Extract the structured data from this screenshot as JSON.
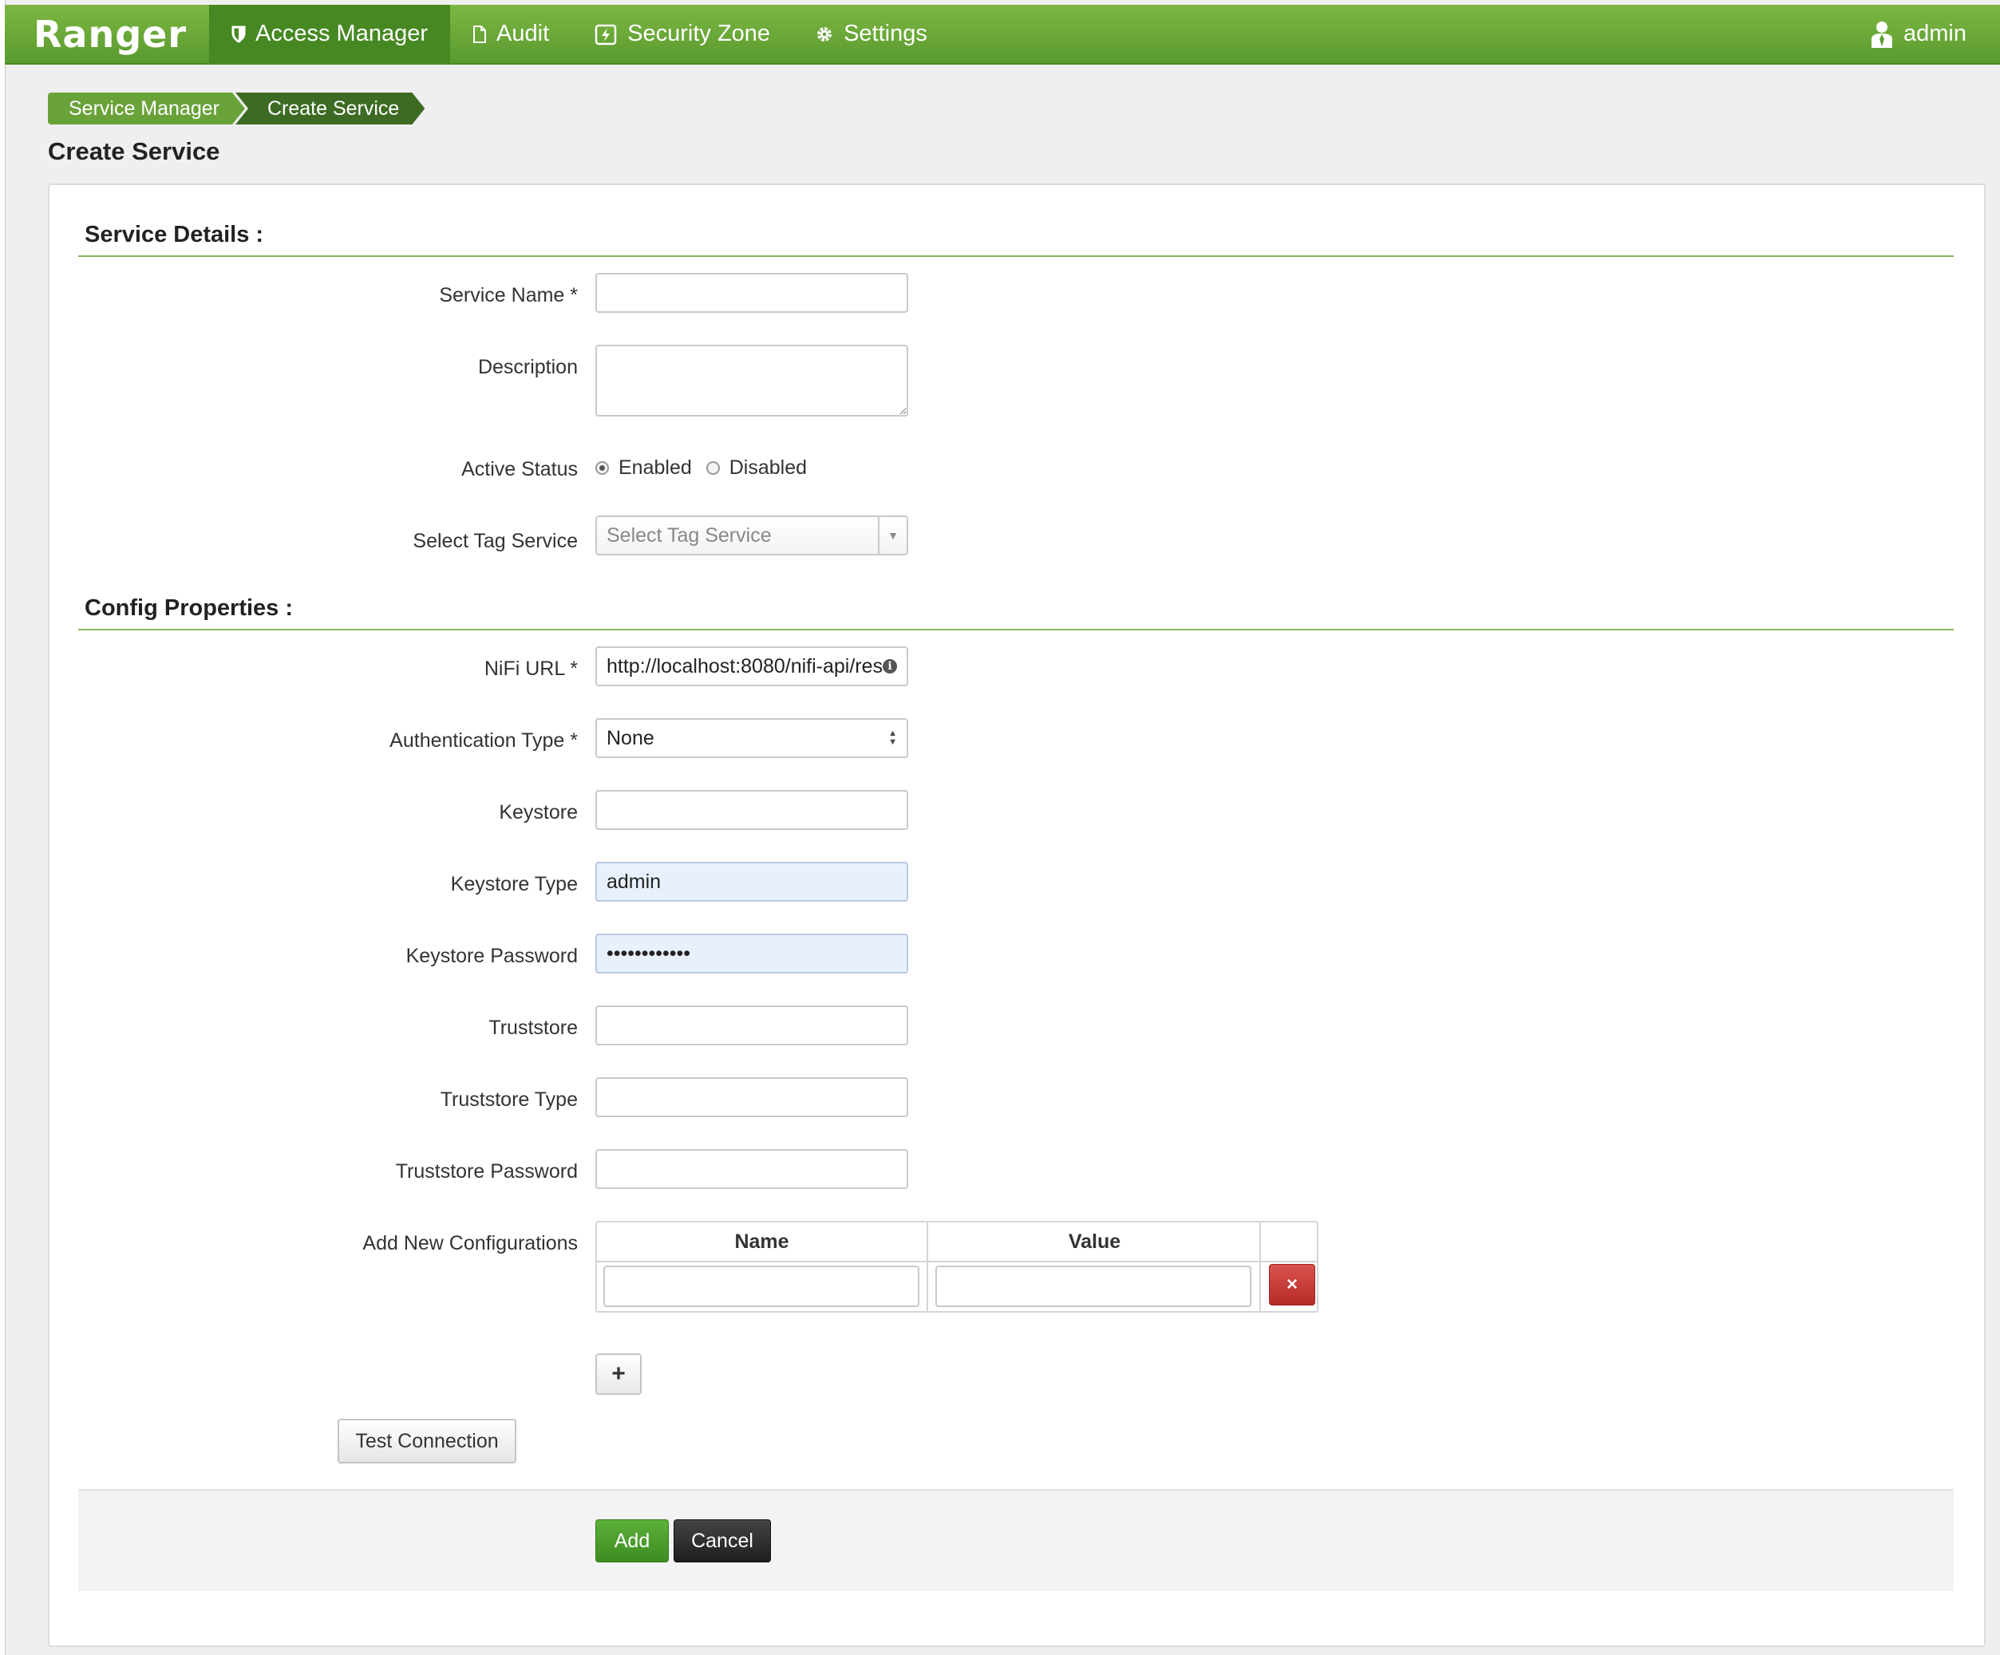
{
  "navbar": {
    "brand": "Ranger",
    "items": [
      {
        "label": "Access Manager",
        "icon": "shield-icon"
      },
      {
        "label": "Audit",
        "icon": "file-icon"
      },
      {
        "label": "Security Zone",
        "icon": "zone-icon"
      },
      {
        "label": "Settings",
        "icon": "gear-icon"
      }
    ],
    "user": {
      "label": "admin",
      "icon": "user-icon"
    }
  },
  "breadcrumb": [
    "Service Manager",
    "Create Service"
  ],
  "page_title": "Create Service",
  "service_details": {
    "title": "Service Details :",
    "service_name_label": "Service Name *",
    "service_name_value": "",
    "description_label": "Description",
    "description_value": "",
    "active_status_label": "Active Status",
    "active_status_options": [
      "Enabled",
      "Disabled"
    ],
    "active_status_selected": "Enabled",
    "tag_service_label": "Select Tag Service",
    "tag_service_placeholder": "Select Tag Service"
  },
  "config_properties": {
    "title": "Config Properties :",
    "nifi_url_label": "NiFi URL *",
    "nifi_url_value": "http://localhost:8080/nifi-api/res",
    "auth_type_label": "Authentication Type *",
    "auth_type_value": "None",
    "keystore_label": "Keystore",
    "keystore_value": "",
    "keystore_type_label": "Keystore Type",
    "keystore_type_value": "admin",
    "keystore_password_label": "Keystore Password",
    "keystore_password_value": "••••••••••••",
    "truststore_label": "Truststore",
    "truststore_value": "",
    "truststore_type_label": "Truststore Type",
    "truststore_type_value": "",
    "truststore_password_label": "Truststore Password",
    "truststore_password_value": "",
    "add_new_configs_label": "Add New Configurations",
    "config_table": {
      "columns": [
        "Name",
        "Value"
      ],
      "rows": [
        {
          "name": "",
          "value": ""
        }
      ]
    }
  },
  "buttons": {
    "delete_row": "×",
    "add_row": "+",
    "test_connection": "Test Connection",
    "add": "Add",
    "cancel": "Cancel"
  }
}
